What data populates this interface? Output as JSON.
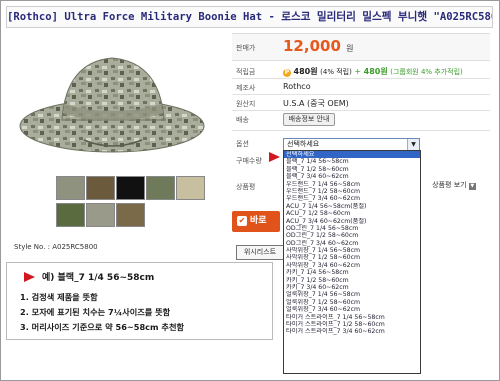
{
  "title": "[Rothco] Ultra Force Military Boonie Hat - 로스코 밀리터리 밀스펙 부니햇 \"A025RC5800\"",
  "price": {
    "label": "판매가",
    "value": "12,000",
    "unit": "원"
  },
  "points": {
    "label": "적립금",
    "icon": "P",
    "value": "480원",
    "rate": "(4% 적립)",
    "extra_plus": "+",
    "extra_value": "480원",
    "extra_note": "(그룹회원 4% 추가적립)"
  },
  "maker": {
    "label": "제조사",
    "value": "Rothco"
  },
  "origin": {
    "label": "원산지",
    "value": "U.S.A (중국 OEM)"
  },
  "shipping": {
    "label": "배송",
    "button": "배송정보 안내"
  },
  "option": {
    "label": "옵션",
    "selected": "선택하세요"
  },
  "qty": {
    "label": "구매수량"
  },
  "review": {
    "label": "상품평",
    "button": "상품평 보기"
  },
  "order_button": "바로",
  "wish_button": "위시리스트",
  "style_no": "Style No. :  A025RC5800",
  "options": [
    "선택하세요",
    "블랙_7 1/4 56~58cm",
    "블랙_7 1/2 58~60cm",
    "블랙_7 3/4 60~62cm",
    "우드랜드_7 1/4 56~58cm",
    "우드랜드_7 1/2 58~60cm",
    "우드랜드_7 3/4 60~62cm",
    "ACU_7 1/4 56~58cm(품절)",
    "ACU_7 1/2 58~60cm",
    "ACU_7 3/4 60~62cm(품절)",
    "OD그린_7 1/4 56~58cm",
    "OD그린_7 1/2 58~60cm",
    "OD그린_7 3/4 60~62cm",
    "사막위장_7 1/4 56~58cm",
    "사막위장_7 1/2 58~60cm",
    "사막위장_7 3/4 60~62cm",
    "카키_7 1/4 56~58cm",
    "카키_7 1/2 58~60cm",
    "카키_7 3/4 60~62cm",
    "얼룩위장_7 1/4 56~58cm",
    "얼룩위장_7 1/2 58~60cm",
    "얼룩위장_7 3/4 60~62cm",
    "타이거 스트라이프_7 1/4 56~58cm",
    "타이거 스트라이프_7 1/2 58~60cm",
    "타이거 스트라이프_7 3/4 60~62cm"
  ],
  "note": {
    "heading": "예) 블랙_7 1/4 56~58cm",
    "lines": [
      "1. 검정색 제품을 뜻함",
      "2. 모자에 표기된 치수는 7¼사이즈를 뜻함",
      "3. 머리사이즈 기준으로 약 56~58cm 추천함"
    ]
  },
  "thumb_colors": [
    "#6a6a3e",
    "#8a7a52",
    "#111111",
    "#6f7a5a",
    "#c8bea0",
    "#5a6b3f",
    "#9a9a8a",
    "#7a6a4a"
  ],
  "colors": {
    "accent": "#e8571c",
    "title_text": "#2a2a7a",
    "select_highlight": "#3165c6",
    "red_arrow": "#d3171e"
  }
}
